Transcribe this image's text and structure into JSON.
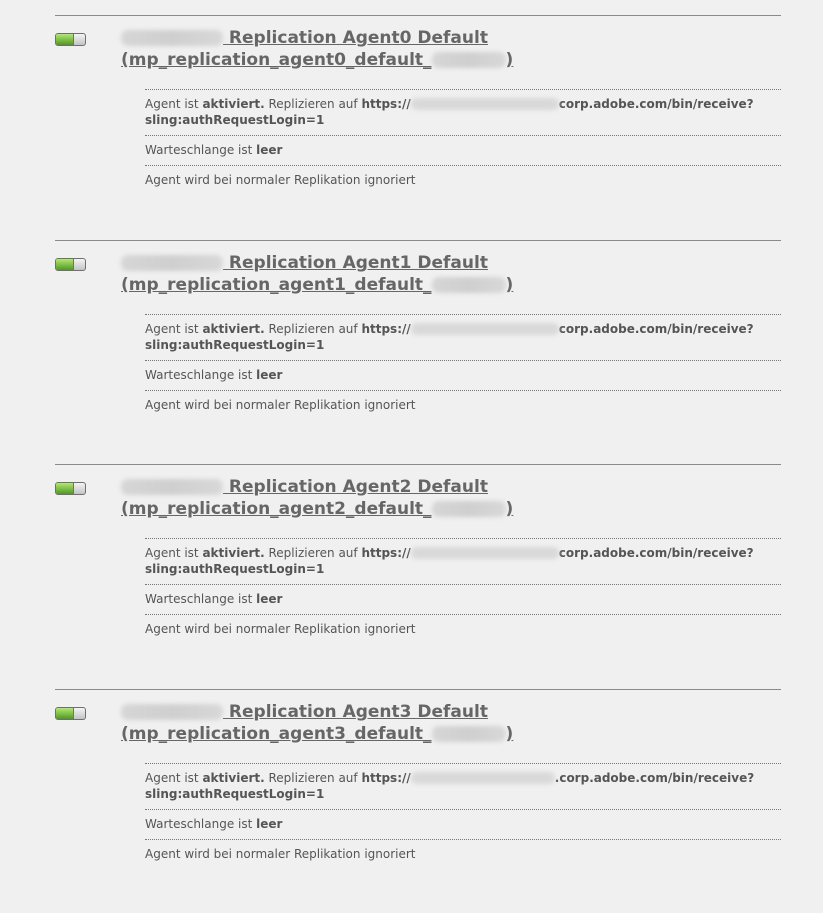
{
  "agents": [
    {
      "title_line1": "Replication Agent0 Default",
      "title_line2_prefix": "(mp_replication_agent0_default_",
      "title_line2_suffix": ")",
      "status": "enabled",
      "enabled_fill": 0.6,
      "detail_agent_prefix": "Agent ist ",
      "detail_agent_state": "aktiviert.",
      "detail_replicate_prefix": " Replizieren auf ",
      "detail_url_scheme": "https://",
      "detail_url_suffix": "corp.adobe.com/bin/receive?",
      "detail_url_line2": "sling:authRequestLogin=1",
      "queue_prefix": "Warteschlange ist ",
      "queue_state": "leer",
      "ignore_text": "Agent wird bei normaler Replikation ignoriert"
    },
    {
      "title_line1": "Replication Agent1 Default",
      "title_line2_prefix": "(mp_replication_agent1_default_",
      "title_line2_suffix": ")",
      "status": "enabled",
      "enabled_fill": 0.6,
      "detail_agent_prefix": "Agent ist ",
      "detail_agent_state": "aktiviert.",
      "detail_replicate_prefix": " Replizieren auf ",
      "detail_url_scheme": "https://",
      "detail_url_suffix": "corp.adobe.com/bin/receive?",
      "detail_url_line2": "sling:authRequestLogin=1",
      "queue_prefix": "Warteschlange ist ",
      "queue_state": "leer",
      "ignore_text": "Agent wird bei normaler Replikation ignoriert"
    },
    {
      "title_line1": "Replication Agent2 Default",
      "title_line2_prefix": "(mp_replication_agent2_default_",
      "title_line2_suffix": ")",
      "status": "enabled",
      "enabled_fill": 0.6,
      "detail_agent_prefix": "Agent ist ",
      "detail_agent_state": "aktiviert.",
      "detail_replicate_prefix": " Replizieren auf ",
      "detail_url_scheme": "https://",
      "detail_url_suffix": "corp.adobe.com/bin/receive?",
      "detail_url_line2": "sling:authRequestLogin=1",
      "queue_prefix": "Warteschlange ist ",
      "queue_state": "leer",
      "ignore_text": "Agent wird bei normaler Replikation ignoriert"
    },
    {
      "title_line1": "Replication Agent3 Default",
      "title_line2_prefix": "(mp_replication_agent3_default_",
      "title_line2_suffix": ")",
      "status": "enabled",
      "enabled_fill": 0.6,
      "detail_agent_prefix": "Agent ist ",
      "detail_agent_state": "aktiviert.",
      "detail_replicate_prefix": " Replizieren auf ",
      "detail_url_scheme": "https://",
      "detail_url_suffix": ".corp.adobe.com/bin/receive?",
      "detail_url_line2": "sling:authRequestLogin=1",
      "queue_prefix": "Warteschlange ist ",
      "queue_state": "leer",
      "ignore_text": "Agent wird bei normaler Replikation ignoriert"
    }
  ],
  "colors": {
    "background": "#f0f0f0",
    "text": "#555555",
    "title": "#666666",
    "toggle_on": "#6ab42f"
  }
}
